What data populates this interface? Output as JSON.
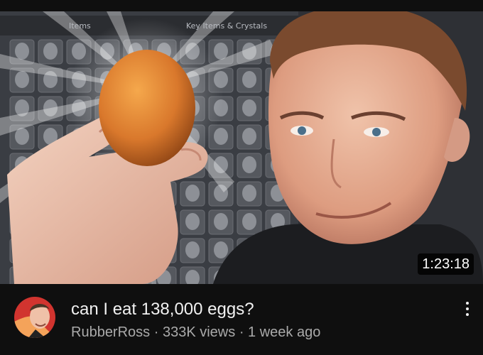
{
  "thumbnail": {
    "tabs": [
      "Items",
      "Key Items & Crystals"
    ],
    "duration": "1:23:18"
  },
  "video": {
    "title": "can I eat 138,000 eggs?",
    "channel": "RubberRoss",
    "views": "333K views",
    "age": "1 week ago",
    "separator": "·"
  },
  "icons": {
    "more": "vertical-dots-icon",
    "avatar": "channel-avatar"
  }
}
